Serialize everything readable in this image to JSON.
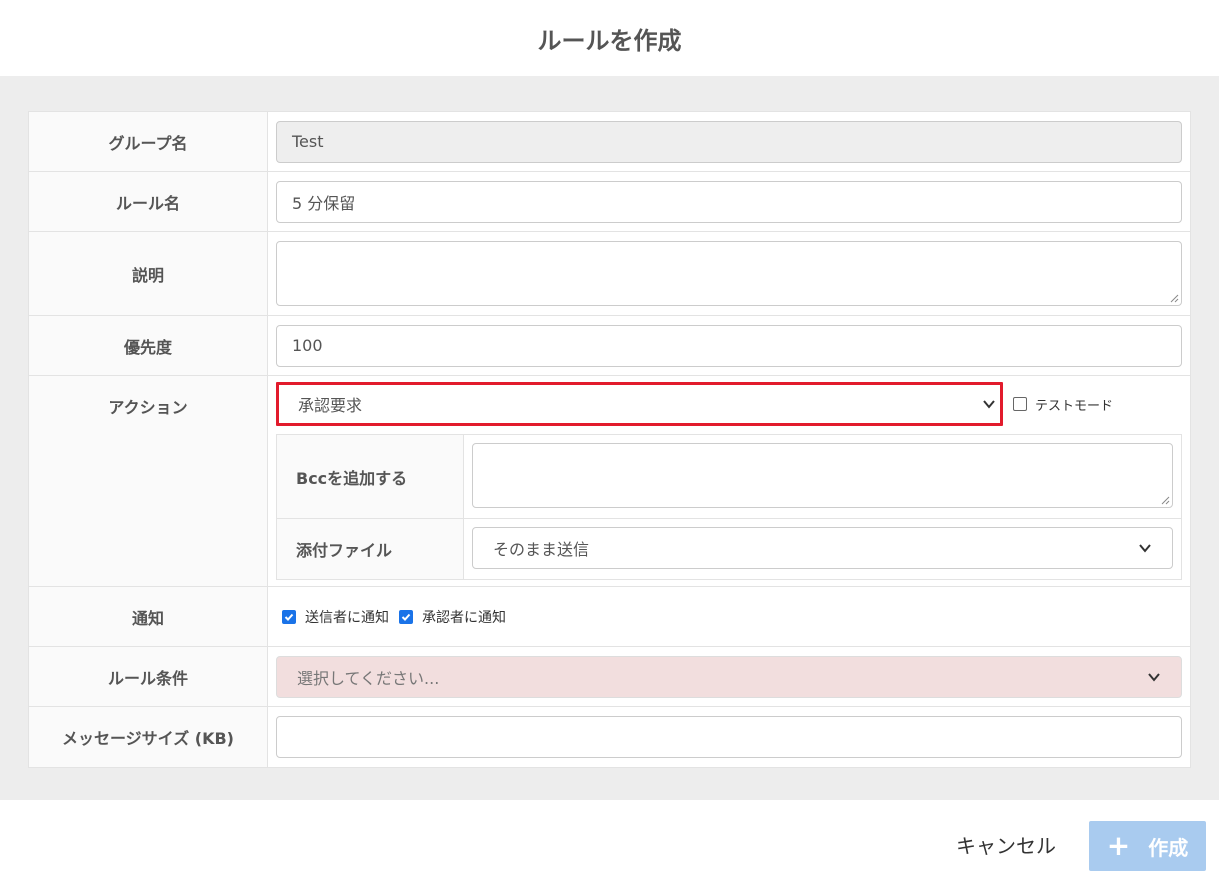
{
  "dialog": {
    "title": "ルールを作成"
  },
  "form": {
    "group_name": {
      "label": "グループ名",
      "value": "Test"
    },
    "rule_name": {
      "label": "ルール名",
      "value": "5 分保留"
    },
    "description": {
      "label": "説明",
      "value": ""
    },
    "priority": {
      "label": "優先度",
      "value": "100"
    },
    "action": {
      "label": "アクション",
      "selected": "承認要求",
      "test_mode_label": "テストモード",
      "test_mode_checked": false,
      "bcc": {
        "label": "Bccを追加する",
        "value": ""
      },
      "attachment": {
        "label": "添付ファイル",
        "selected": "そのまま送信"
      }
    },
    "notification": {
      "label": "通知",
      "notify_sender": "送信者に通知",
      "notify_sender_checked": true,
      "notify_approver": "承認者に通知",
      "notify_approver_checked": true
    },
    "rule_condition": {
      "label": "ルール条件",
      "placeholder": "選択してください..."
    },
    "message_size": {
      "label": "メッセージサイズ (KB)",
      "value": ""
    }
  },
  "footer": {
    "cancel_label": "キャンセル",
    "create_label": "作成"
  },
  "colors": {
    "highlight": "#e21b2c",
    "primary_disabled": "#a9cbef",
    "invalid_bg": "#f2dede",
    "checkbox": "#1a73e8"
  }
}
